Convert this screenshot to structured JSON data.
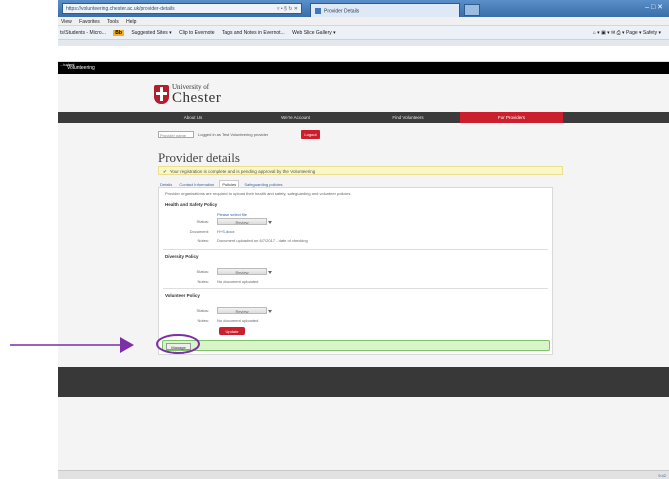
{
  "browser": {
    "address": "https://volunteering.chester.ac.uk/provider-details",
    "address_controls": "▿ • § ↻ ✕",
    "tab_title": "Provider Details",
    "window_controls": "–  □  ✕",
    "menu": [
      "View",
      "Favorites",
      "Tools",
      "Help"
    ],
    "favorites": {
      "item1": "ts\\Students - Micro...",
      "badge": "Bb",
      "item2": "Suggested Sites ▾",
      "item3": "Clip to Evernote",
      "item4": "Tags and Notes in Evernot...",
      "item5": "Web Slice Gallery ▾",
      "right": "⌂ ▾ ▣ ▾ ✉ ⎙ ▾ Page ▾  Safety ▾"
    }
  },
  "site": {
    "top_label": "...tudent",
    "app_name": "Volunteering",
    "logo": {
      "university_of": "University of",
      "name": "Chester"
    },
    "nav": [
      "About Us",
      "We're Account",
      "Find Volunteers",
      "For Providers"
    ]
  },
  "user": {
    "provider_name_placeholder": "Provider name",
    "logged_in_text": "Logged in as Test Volunteering provider",
    "logout_label": "Logout"
  },
  "page": {
    "title": "Provider details",
    "notice": "Your registration is complete and is pending approval by the Volunteering",
    "tabs": [
      "Details",
      "Contact Information",
      "Policies",
      "Safeguarding policies"
    ],
    "panel_intro": "Provider organisations are required to upload their health and safety, safeguarding and volunteer policies.",
    "sections": [
      {
        "heading": "Health and Safety Policy",
        "upload_link": "Please select file",
        "status_label": "Status:",
        "status_value": "Review",
        "document_label": "Document:",
        "document_value": "H+S.docx",
        "notes_label": "Notes:",
        "notes_value": "Document uploaded on 6/7/2017 - date of checking"
      },
      {
        "heading": "Diversity Policy",
        "status_label": "Status:",
        "status_value": "Review",
        "notes_label": "Notes:",
        "notes_value": "No document uploaded"
      },
      {
        "heading": "Volunteer Policy",
        "status_label": "Status:",
        "status_value": "Review",
        "notes_label": "Notes:",
        "notes_value": "No document uploaded"
      }
    ],
    "update_label": "Update",
    "manage_users_label": "Manage Users"
  },
  "taskbar": {
    "clock": "9:42"
  },
  "colors": {
    "brand_red": "#cc1f2e",
    "nav_dark": "#3b3b3b",
    "notice_yellow": "#fbf6c5",
    "success_green": "#d8f4c8",
    "annotation_purple": "#7b2fa8"
  }
}
